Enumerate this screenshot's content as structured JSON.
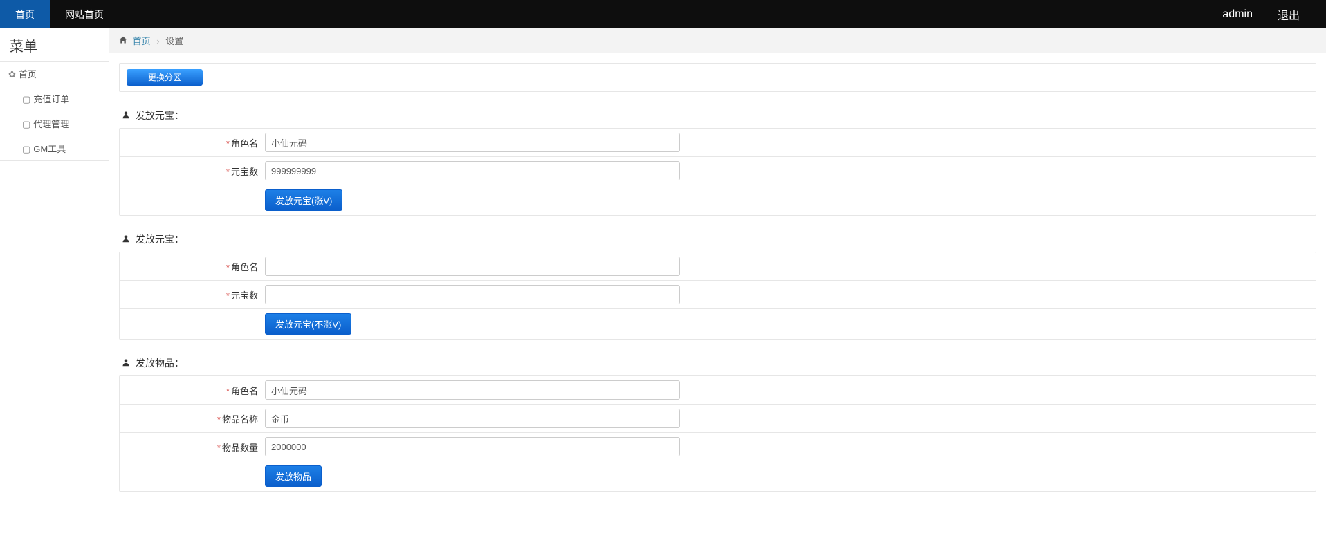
{
  "topnav": {
    "home": "首页",
    "site_home": "网站首页",
    "user": "admin",
    "logout": "退出"
  },
  "sidebar": {
    "title": "菜单",
    "home": "首页",
    "items": [
      {
        "label": "充值订单"
      },
      {
        "label": "代理管理"
      },
      {
        "label": "GM工具"
      }
    ]
  },
  "breadcrumb": {
    "home": "首页",
    "current": "设置"
  },
  "zone_button": "更换分区",
  "sections": {
    "s1": {
      "title": "发放元宝：",
      "role_label": "角色名",
      "role_value": "小仙元码",
      "amount_label": "元宝数",
      "amount_value": "999999999",
      "submit": "发放元宝(涨V)"
    },
    "s2": {
      "title": "发放元宝：",
      "role_label": "角色名",
      "role_value": "",
      "amount_label": "元宝数",
      "amount_value": "",
      "submit": "发放元宝(不涨V)"
    },
    "s3": {
      "title": "发放物品：",
      "role_label": "角色名",
      "role_value": "小仙元码",
      "item_name_label": "物品名称",
      "item_name_value": "金币",
      "item_qty_label": "物品数量",
      "item_qty_value": "2000000",
      "submit": "发放物品"
    }
  }
}
